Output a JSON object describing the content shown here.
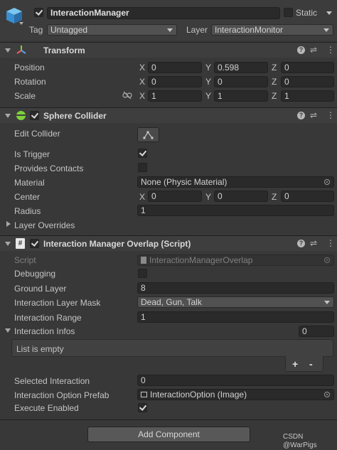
{
  "header": {
    "name": "InteractionManager",
    "static_label": "Static",
    "tag_label": "Tag",
    "tag_value": "Untagged",
    "layer_label": "Layer",
    "layer_value": "InteractionMonitor"
  },
  "transform": {
    "title": "Transform",
    "position_label": "Position",
    "rotation_label": "Rotation",
    "scale_label": "Scale",
    "axis_x": "X",
    "axis_y": "Y",
    "axis_z": "Z",
    "position": {
      "x": "0",
      "y": "0.598",
      "z": "0"
    },
    "rotation": {
      "x": "0",
      "y": "0",
      "z": "0"
    },
    "scale": {
      "x": "1",
      "y": "1",
      "z": "1"
    }
  },
  "sphere_collider": {
    "title": "Sphere Collider",
    "edit_collider_label": "Edit Collider",
    "is_trigger_label": "Is Trigger",
    "provides_contacts_label": "Provides Contacts",
    "material_label": "Material",
    "material_value": "None (Physic Material)",
    "center_label": "Center",
    "center": {
      "x": "0",
      "y": "0",
      "z": "0"
    },
    "radius_label": "Radius",
    "radius_value": "1",
    "layer_overrides_label": "Layer Overrides"
  },
  "script_component": {
    "title": "Interaction Manager Overlap (Script)",
    "script_label": "Script",
    "script_value": "InteractionManagerOverlap",
    "debugging_label": "Debugging",
    "ground_layer_label": "Ground Layer",
    "ground_layer_value": "8",
    "mask_label": "Interaction Layer Mask",
    "mask_value": "Dead, Gun, Talk",
    "range_label": "Interaction Range",
    "range_value": "1",
    "infos_label": "Interaction Infos",
    "infos_count": "0",
    "list_empty": "List is empty",
    "add_symbol": "+",
    "remove_symbol": "-",
    "selected_label": "Selected Interaction",
    "selected_value": "0",
    "prefab_label": "Interaction Option Prefab",
    "prefab_value": "InteractionOption (Image)",
    "execute_label": "Execute Enabled"
  },
  "add_component_label": "Add Component",
  "watermark": "CSDN @WarPigs",
  "colors": {
    "panel": "#383838",
    "field": "#2a2a2a",
    "header": "#3e3e3e",
    "accent_green": "#7fd13b"
  }
}
